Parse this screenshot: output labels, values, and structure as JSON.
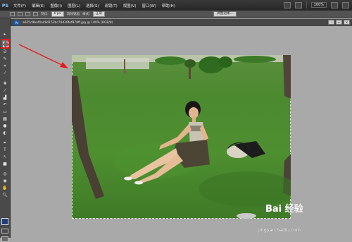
{
  "app": {
    "logo": "PS"
  },
  "menu": {
    "items": [
      "文件(F)",
      "编辑(E)",
      "图像(I)",
      "图层(L)",
      "选择(S)",
      "滤镜(T)",
      "视图(V)",
      "窗口(W)",
      "帮助(H)"
    ],
    "zoom": "100%"
  },
  "options": {
    "feather_label": "羽化:",
    "feather_value": "0 px",
    "antialias_label": "消除锯齿",
    "style_label": "样式:",
    "style_value": "正常",
    "refine_label": "调整边缘..."
  },
  "document": {
    "tab_title": "a655c9bef4ad9d153bc74d39fef878ff.jpg @ 100% (RGB/8)"
  },
  "watermark": {
    "logo": "Bai 经验",
    "url": "jingyan.baidu.com"
  }
}
